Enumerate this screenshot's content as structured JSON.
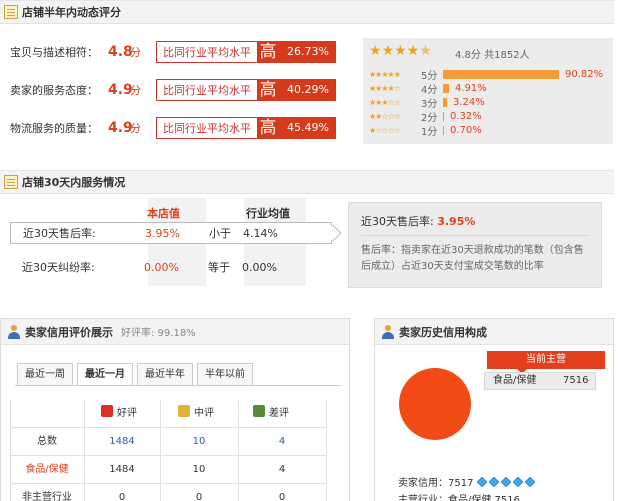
{
  "section1": {
    "title": "店铺半年内动态评分",
    "rows": [
      {
        "label": "宝贝与描述相符：",
        "score": "4.8",
        "unit": "分",
        "compare": "比同行业平均水平",
        "level": "高",
        "pct": "26.73%"
      },
      {
        "label": "卖家的服务态度：",
        "score": "4.9",
        "unit": "分",
        "compare": "比同行业平均水平",
        "level": "高",
        "pct": "40.29%"
      },
      {
        "label": "物流服务的质量：",
        "score": "4.9",
        "unit": "分",
        "compare": "比同行业平均水平",
        "level": "高",
        "pct": "45.49%"
      }
    ],
    "rating_summary": {
      "score": "4.8分",
      "total": "共1852人"
    },
    "distribution": [
      {
        "label": "5分",
        "pct": "90.82%",
        "value": 90.82
      },
      {
        "label": "4分",
        "pct": "4.91%",
        "value": 4.91
      },
      {
        "label": "3分",
        "pct": "3.24%",
        "value": 3.24
      },
      {
        "label": "2分",
        "pct": "0.32%",
        "value": 0.32
      },
      {
        "label": "1分",
        "pct": "0.70%",
        "value": 0.7
      }
    ]
  },
  "section2": {
    "title": "店铺30天内服务情况",
    "col_store": "本店值",
    "col_industry": "行业均值",
    "rows": [
      {
        "label": "近30天售后率:",
        "store": "3.95%",
        "relation": "小于",
        "industry": "4.14%"
      },
      {
        "label": "近30天纠纷率:",
        "store": "0.00%",
        "relation": "等于",
        "industry": "0.00%"
      }
    ],
    "box_title": "近30天售后率:",
    "box_value": "3.95%",
    "box_desc": "售后率：指卖家在近30天退款成功的笔数（包含售后成立）占近30天支付宝成交笔数的比率"
  },
  "section3": {
    "left_title": "卖家信用评价展示",
    "good_rate": "好评率: 99.18%",
    "tabs": [
      "最近一周",
      "最近一月",
      "最近半年",
      "半年以前"
    ],
    "active_tab": 1,
    "col_good": "好评",
    "col_mid": "中评",
    "col_bad": "差评",
    "table": [
      {
        "label": "总数",
        "good": "1484",
        "mid": "10",
        "bad": "4"
      },
      {
        "label": "食品/保健",
        "good": "1484",
        "mid": "10",
        "bad": "4"
      },
      {
        "label": "非主营行业",
        "good": "0",
        "mid": "0",
        "bad": "0"
      }
    ],
    "right_title": "卖家历史信用构成",
    "main_badge": "当前主营",
    "main_cat": "食品/保健",
    "main_cat_value": "7516",
    "credit_label": "卖家信用：7517",
    "main_industry": "主营行业：食品/保健 7516",
    "colors": {
      "accent": "#e2401c",
      "pie": "#f24b16"
    }
  }
}
